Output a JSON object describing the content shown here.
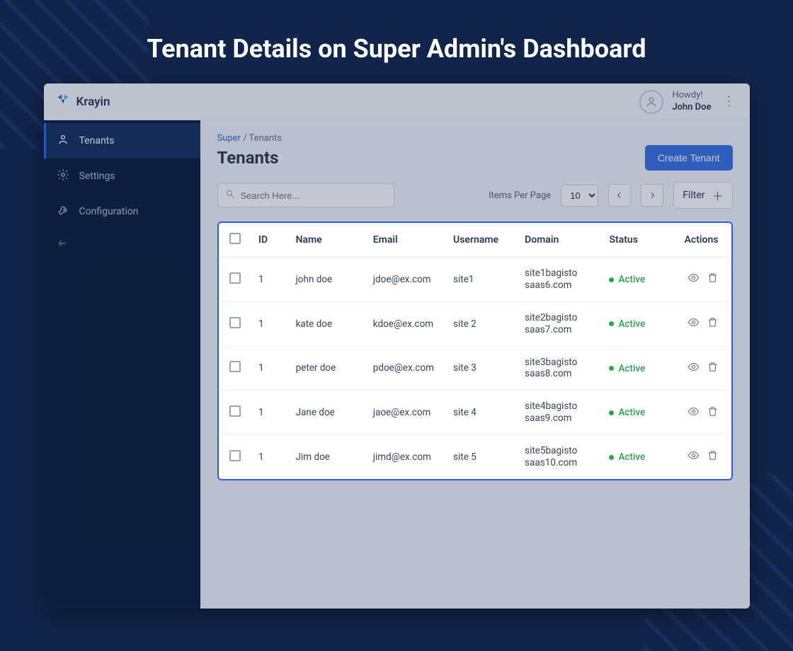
{
  "outer_title": "Tenant Details on Super Admin's Dashboard",
  "brand": {
    "name": "Krayin"
  },
  "topbar": {
    "greeting": "Howdy!",
    "username": "John Doe"
  },
  "sidebar": {
    "items": [
      {
        "label": "Tenants",
        "icon": "user"
      },
      {
        "label": "Settings",
        "icon": "gear"
      },
      {
        "label": "Configuration",
        "icon": "wrench"
      }
    ]
  },
  "breadcrumb": {
    "root": "Super",
    "sep": " / ",
    "current": "Tenants"
  },
  "page": {
    "title": "Tenants",
    "create_button": "Create Tenant"
  },
  "toolbar": {
    "search_placeholder": "Search Here...",
    "items_per_page_label": "Items Per Page",
    "items_per_page_value": "10",
    "filter_label": "Filter"
  },
  "columns": {
    "id": "ID",
    "name": "Name",
    "email": "Email",
    "username": "Username",
    "domain": "Domain",
    "status": "Status",
    "actions": "Actions"
  },
  "status_active": "Active",
  "rows": [
    {
      "id": "1",
      "name": "john doe",
      "email": "jdoe@ex.com",
      "username": "site1",
      "domain_l1": "site1bagisto",
      "domain_l2": "saas6.com",
      "status": "Active"
    },
    {
      "id": "1",
      "name": "kate doe",
      "email": "kdoe@ex.com",
      "username": "site 2",
      "domain_l1": "site2bagisto",
      "domain_l2": "saas7.com",
      "status": "Active"
    },
    {
      "id": "1",
      "name": "peter doe",
      "email": "pdoe@ex.com",
      "username": "site 3",
      "domain_l1": "site3bagisto",
      "domain_l2": "saas8.com",
      "status": "Active"
    },
    {
      "id": "1",
      "name": "Jane doe",
      "email": "jaoe@ex.com",
      "username": "site 4",
      "domain_l1": "site4bagisto",
      "domain_l2": "saas9.com",
      "status": "Active"
    },
    {
      "id": "1",
      "name": "Jim doe",
      "email": "jimd@ex.com",
      "username": "site 5",
      "domain_l1": "site5bagisto",
      "domain_l2": "saas10.com",
      "status": "Active"
    }
  ]
}
